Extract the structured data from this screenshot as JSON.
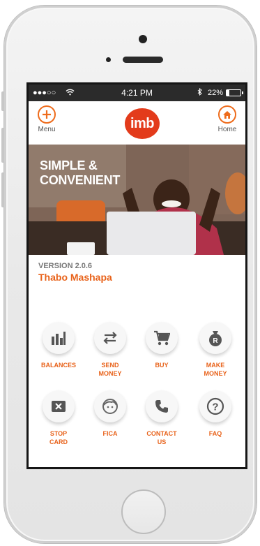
{
  "status_bar": {
    "signal": "●●●○○",
    "time": "4:21 PM",
    "battery": "22%"
  },
  "header": {
    "menu_label": "Menu",
    "home_label": "Home",
    "logo_text": "imb",
    "accent_color": "#ee6b1b"
  },
  "banner": {
    "line1": "SIMPLE &",
    "line2": "CONVENIENT"
  },
  "profile": {
    "version": "VERSION 2.0.6",
    "name": "Thabo Mashapa"
  },
  "tiles": [
    {
      "icon": "bar-chart-icon",
      "line1": "BALANCES",
      "line2": ""
    },
    {
      "icon": "transfer-arrows-icon",
      "line1": "SEND",
      "line2": "MONEY"
    },
    {
      "icon": "cart-icon",
      "line1": "BUY",
      "line2": ""
    },
    {
      "icon": "money-bag-icon",
      "line1": "MAKE",
      "line2": "MONEY"
    },
    {
      "icon": "stop-card-icon",
      "line1": "STOP",
      "line2": "CARD"
    },
    {
      "icon": "face-icon",
      "line1": "FICA",
      "line2": ""
    },
    {
      "icon": "phone-icon",
      "line1": "CONTACT",
      "line2": "US"
    },
    {
      "icon": "question-icon",
      "line1": "FAQ",
      "line2": ""
    }
  ]
}
